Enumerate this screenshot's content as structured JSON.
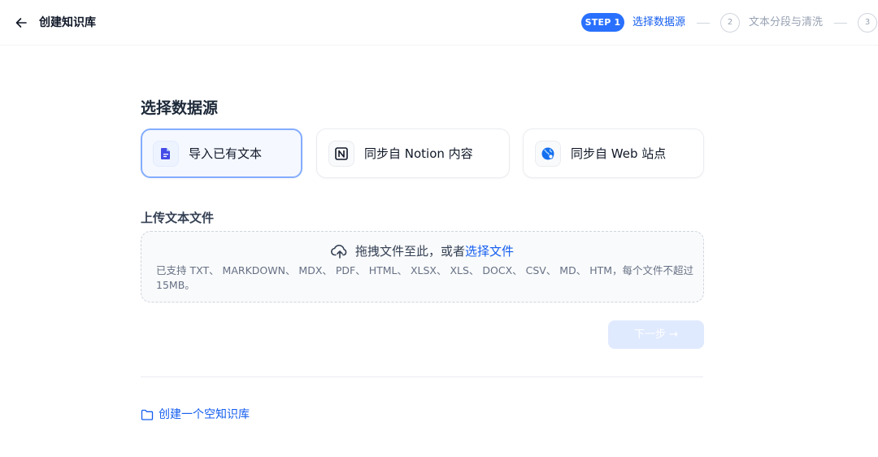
{
  "header": {
    "title": "创建知识库",
    "back_icon": "arrow-left-icon"
  },
  "steps": {
    "active_badge": "STEP 1",
    "active_label": "选择数据源",
    "step2_number": "2",
    "step2_label": "文本分段与清洗",
    "step3_number": "3"
  },
  "main": {
    "section_title": "选择数据源",
    "sources": [
      {
        "label": "导入已有文本",
        "icon": "document-icon",
        "selected": true
      },
      {
        "label": "同步自 Notion 内容",
        "icon": "notion-icon",
        "selected": false
      },
      {
        "label": "同步自 Web 站点",
        "icon": "web-globe-icon",
        "selected": false
      }
    ],
    "upload_title": "上传文本文件",
    "dropzone": {
      "prompt": "拖拽文件至此，或者 ",
      "link": "选择文件",
      "hint": "已支持 TXT、 MARKDOWN、 MDX、 PDF、 HTML、 XLSX、 XLS、 DOCX、 CSV、 MD、 HTM，每个文件不超过 15MB。"
    },
    "next_button": "下一步 →",
    "create_empty_link": "创建一个空知识库"
  },
  "colors": {
    "accent": "#2970ff",
    "link": "#155eef",
    "disabled_button": "#e0eaff"
  }
}
